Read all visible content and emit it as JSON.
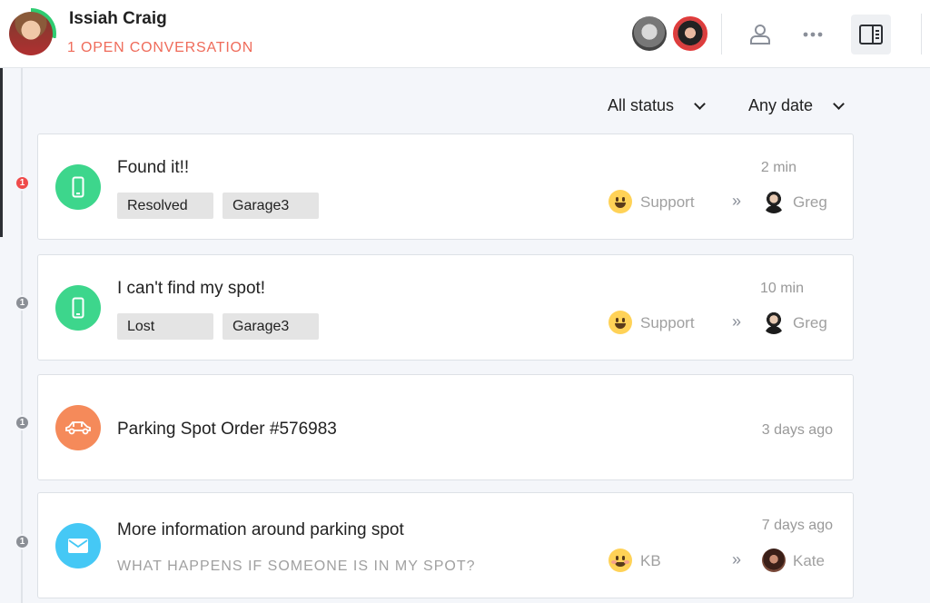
{
  "header": {
    "name": "Issiah Craig",
    "status": "1 OPEN CONVERSATION"
  },
  "filters": {
    "status": "All status",
    "date": "Any date"
  },
  "conversations": [
    {
      "badge": "1",
      "icon": "phone-icon",
      "title": "Found it!!",
      "tags": [
        "Resolved",
        "Garage3"
      ],
      "time": "2 min",
      "team": "Support",
      "agent": "Greg"
    },
    {
      "badge": "1",
      "icon": "phone-icon",
      "title": "I can't find my spot!",
      "tags": [
        "Lost",
        "Garage3"
      ],
      "time": "10 min",
      "team": "Support",
      "agent": "Greg"
    },
    {
      "badge": "1",
      "icon": "car-icon",
      "title": "Parking Spot Order #576983",
      "time": "3 days ago"
    },
    {
      "badge": "1",
      "icon": "mail-icon",
      "title": "More information around parking spot",
      "preview": "WHAT HAPPENS IF SOMEONE IS IN MY SPOT?",
      "time": "7 days ago",
      "team": "KB",
      "agent": "Kate"
    }
  ],
  "colors": {
    "accent_red": "#ef6b5a",
    "unread_badge": "#ef4b4b",
    "green": "#3dd68c",
    "orange": "#f58a5a",
    "blue": "#45c8f5"
  }
}
